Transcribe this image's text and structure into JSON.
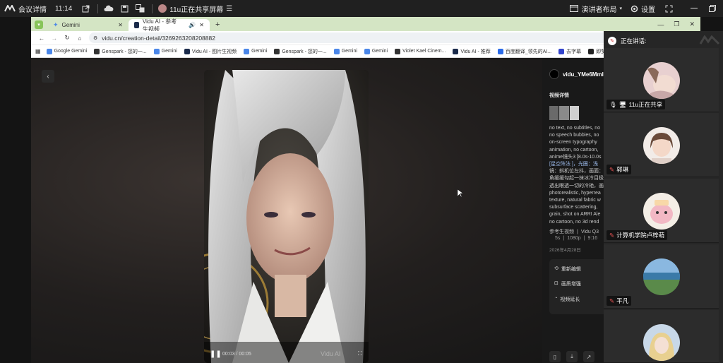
{
  "topbar": {
    "logo_label": "会议详情",
    "time": "11:14",
    "share_status": "11u正在共享屏幕",
    "speaker_layout": "演讲者布局",
    "settings": "设置"
  },
  "browser": {
    "tabs": [
      {
        "label": "Gemini"
      },
      {
        "label": "Vidu AI - 参考生视频"
      }
    ],
    "url": "vidu.cn/creation-detail/3269263208208882",
    "bookmarks": [
      {
        "label": "Google Gemini",
        "color": "#4a86e8"
      },
      {
        "label": "Genspark - 您的一...",
        "color": "#333333"
      },
      {
        "label": "Gemini",
        "color": "#4a86e8"
      },
      {
        "label": "Vidu AI - 图片生视频",
        "color": "#1a2a4a"
      },
      {
        "label": "Gemini",
        "color": "#4a86e8"
      },
      {
        "label": "Genspark - 您的一...",
        "color": "#333333"
      },
      {
        "label": "Gemini",
        "color": "#4a86e8"
      },
      {
        "label": "Gemini",
        "color": "#4a86e8"
      },
      {
        "label": "Violet Kael Cinem...",
        "color": "#333333"
      },
      {
        "label": "Vidu AI - 推荐",
        "color": "#1a2a4a"
      },
      {
        "label": "百度翻译_领先的AI...",
        "color": "#2a6ae8"
      },
      {
        "label": "去字幕",
        "color": "#3344cc"
      },
      {
        "label": "即梦AI - 创作灵感...",
        "color": "#222222"
      }
    ]
  },
  "video": {
    "time_current": "00:03",
    "time_total": "00:05",
    "watermark": "Vidu AI"
  },
  "detail": {
    "user": "vidu_YMe6Mml",
    "section_title": "视频详情",
    "prompt_lines": [
      "no text, no subtitles, no",
      "no speech bubbles, no",
      "on-screen typography",
      "animation, no cartoon,",
      "anime镜头3 [8.0s-10.0s",
      "[星空阵法 ]，光圈：浅",
      "镜：斜机位左抖，画面：",
      "角缓缓勾起一抹冰冷目极",
      "透出眼透一切的冷艳，画",
      "photorealistic, hyperrea",
      "texture, natural fabric w",
      "subsurface scattering,",
      "grain, shot on ARRI Ale",
      "no cartoon, no 3d rend"
    ],
    "prompt_tag": "星空阵法",
    "meta_type": "参考生视频",
    "meta_model": "Vidu Q3",
    "meta_duration": "5s",
    "meta_resolution": "1080p",
    "meta_ratio": "9:16",
    "date": "2026年4月28日",
    "actions": [
      {
        "label": "重新编辑"
      },
      {
        "label": "画质增强"
      },
      {
        "label": "视频延长"
      }
    ]
  },
  "participants": {
    "title": "正在讲话:",
    "list": [
      {
        "name": "11u正在共享",
        "sharing": true
      },
      {
        "name": "郭琳",
        "sharing": false
      },
      {
        "name": "计算机学院卢梓萌",
        "sharing": false
      },
      {
        "name": "平凡",
        "sharing": false
      },
      {
        "name": "",
        "sharing": false
      }
    ]
  }
}
